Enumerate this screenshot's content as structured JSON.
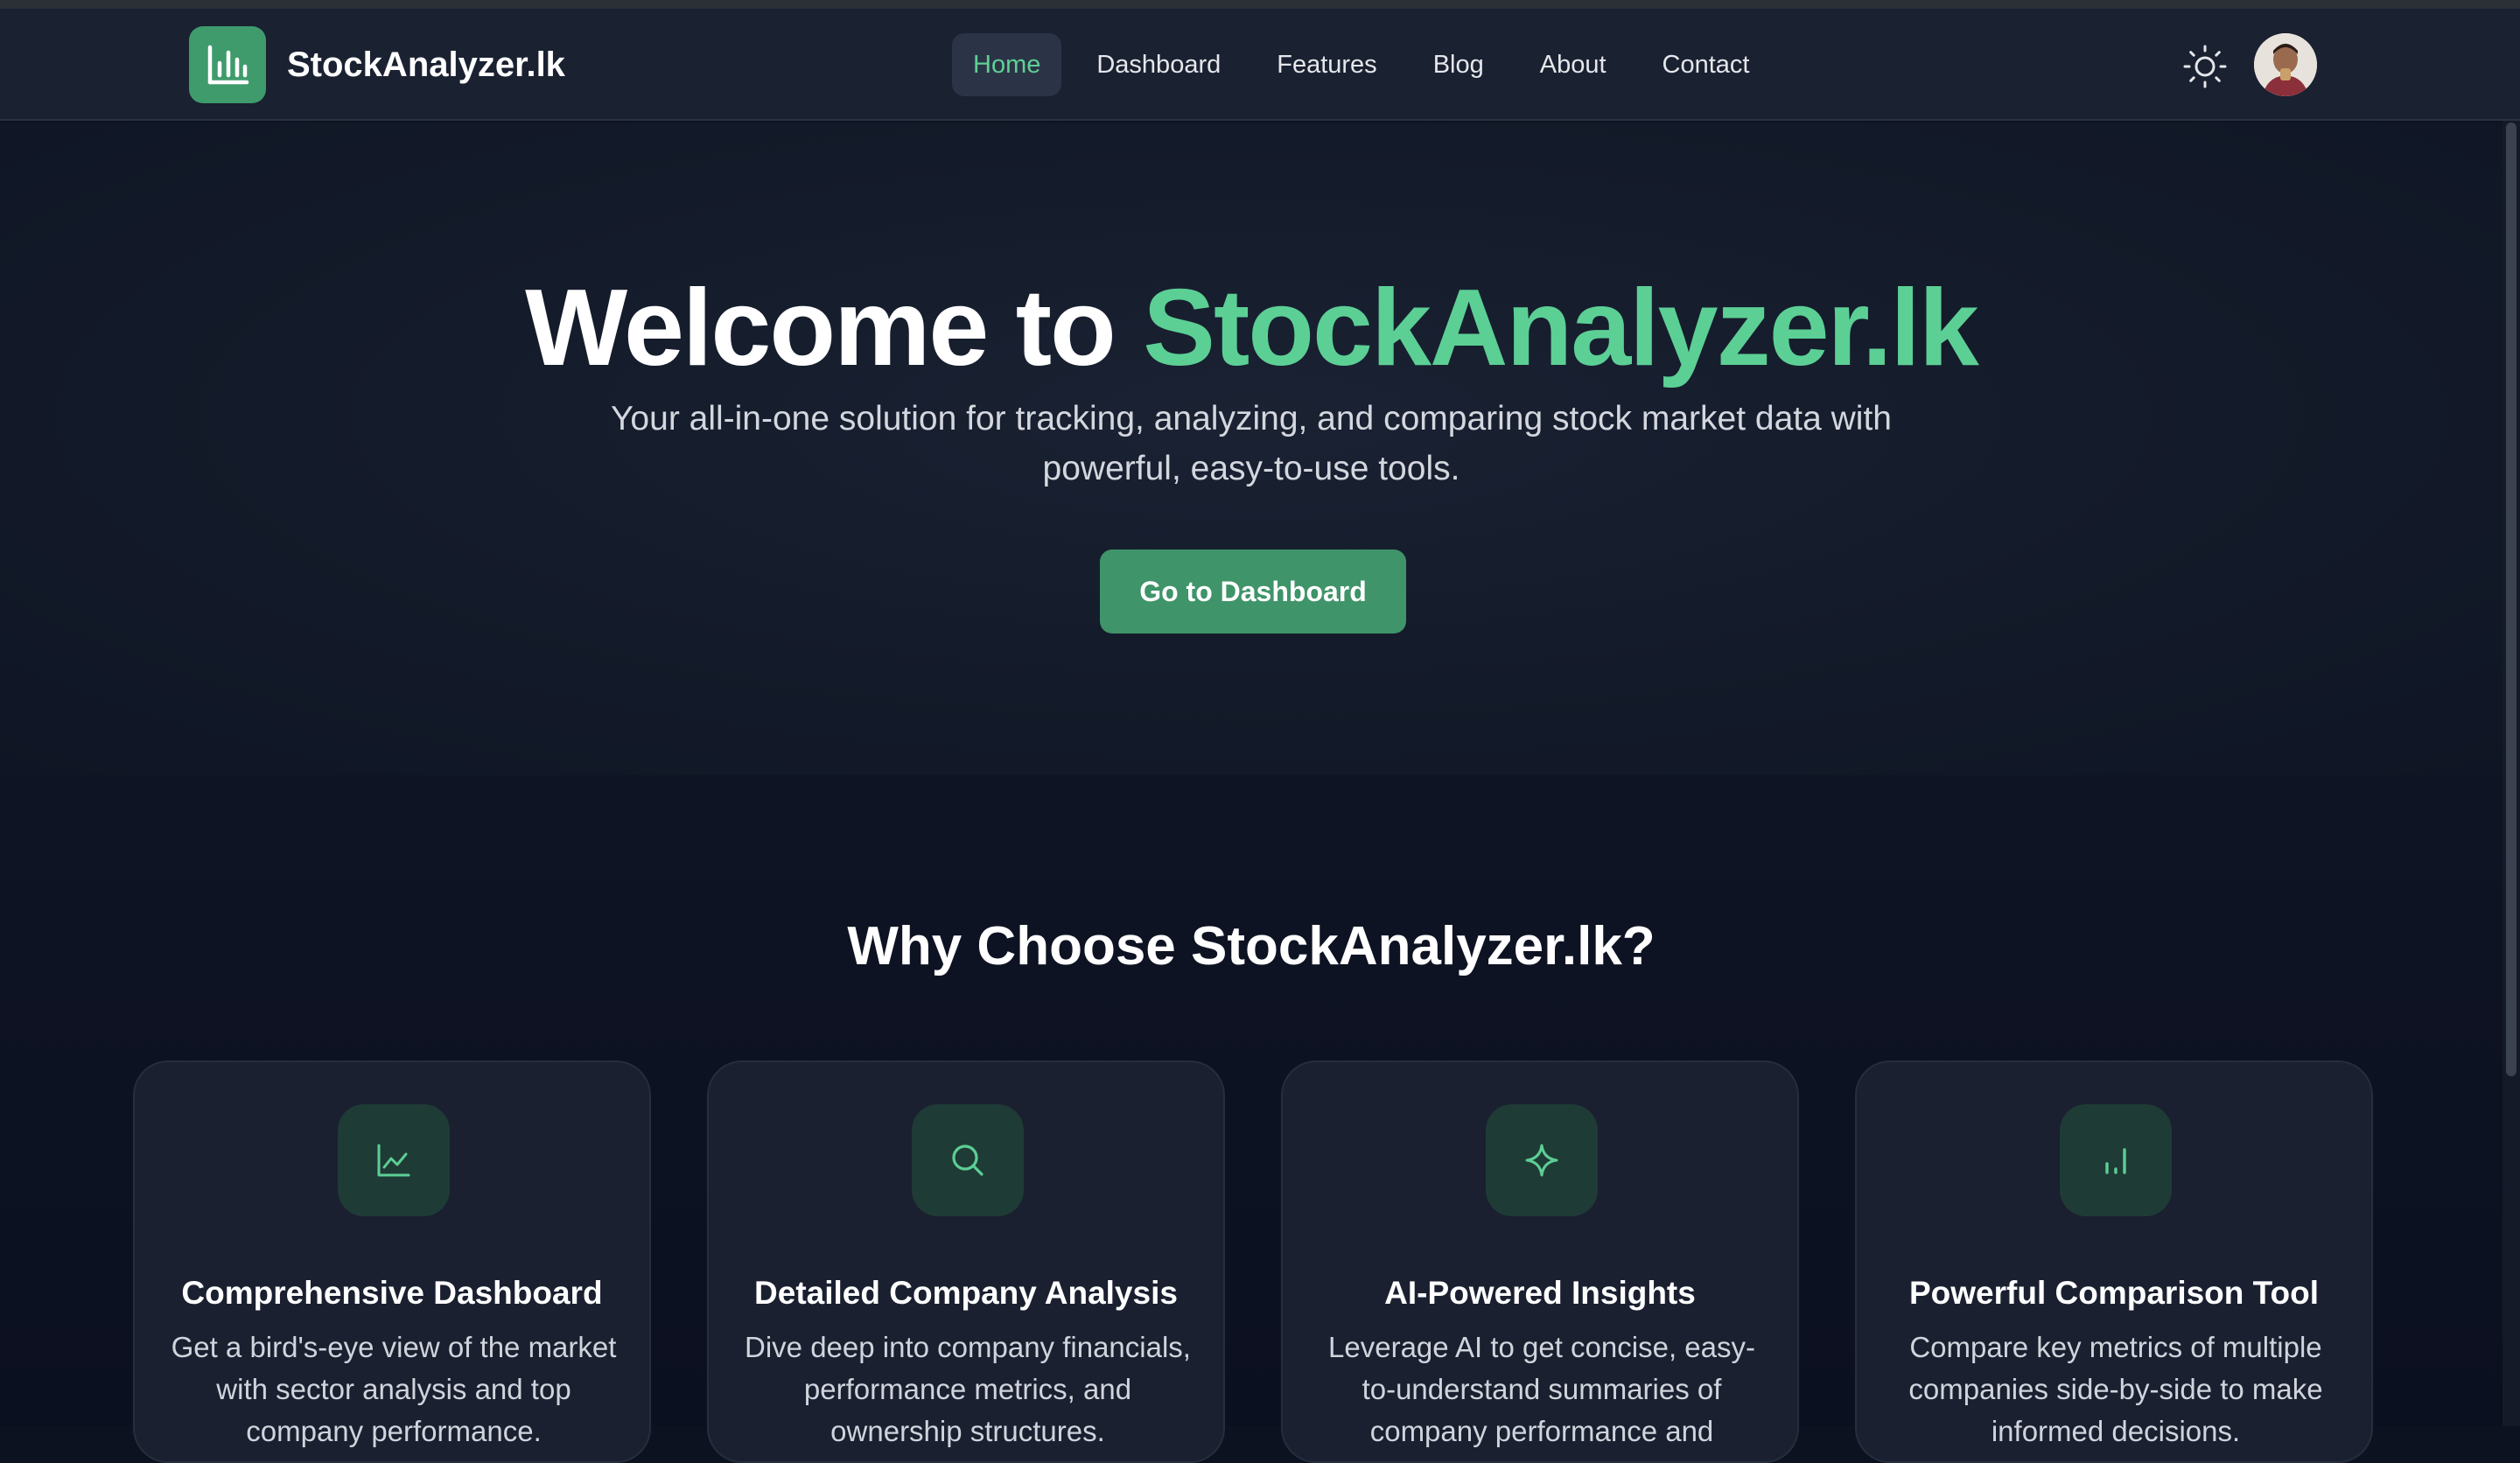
{
  "brand": {
    "name": "StockAnalyzer.lk"
  },
  "nav": {
    "items": [
      {
        "label": "Home",
        "active": true
      },
      {
        "label": "Dashboard",
        "active": false
      },
      {
        "label": "Features",
        "active": false
      },
      {
        "label": "Blog",
        "active": false
      },
      {
        "label": "About",
        "active": false
      },
      {
        "label": "Contact",
        "active": false
      }
    ]
  },
  "header": {
    "theme_icon": "sun-icon",
    "avatar_icon": "user-avatar"
  },
  "hero": {
    "title_prefix": "Welcome to",
    "title_accent": "StockAnalyzer.lk",
    "subtitle": "Your all-in-one solution for tracking, analyzing, and comparing stock market data with powerful, easy-to-use tools.",
    "cta_label": "Go to Dashboard"
  },
  "features": {
    "title": "Why Choose StockAnalyzer.lk?",
    "cards": [
      {
        "icon": "line-chart-icon",
        "title": "Comprehensive Dashboard",
        "desc": "Get a bird's-eye view of the market with sector analysis and top company performance."
      },
      {
        "icon": "search-icon",
        "title": "Detailed Company Analysis",
        "desc": "Dive deep into company financials, performance metrics, and ownership structures."
      },
      {
        "icon": "sparkle-icon",
        "title": "AI-Powered Insights",
        "desc": "Leverage AI to get concise, easy-to-understand summaries of company performance and"
      },
      {
        "icon": "bar-chart-icon",
        "title": "Powerful Comparison Tool",
        "desc": "Compare key metrics of multiple companies side-by-side to make informed decisions."
      }
    ]
  },
  "colors": {
    "accent": "#5ccf95",
    "button": "#3f9469",
    "header_bg": "#1a2131",
    "page_bg": "#0d1220",
    "card_bg": "#1a2030"
  }
}
